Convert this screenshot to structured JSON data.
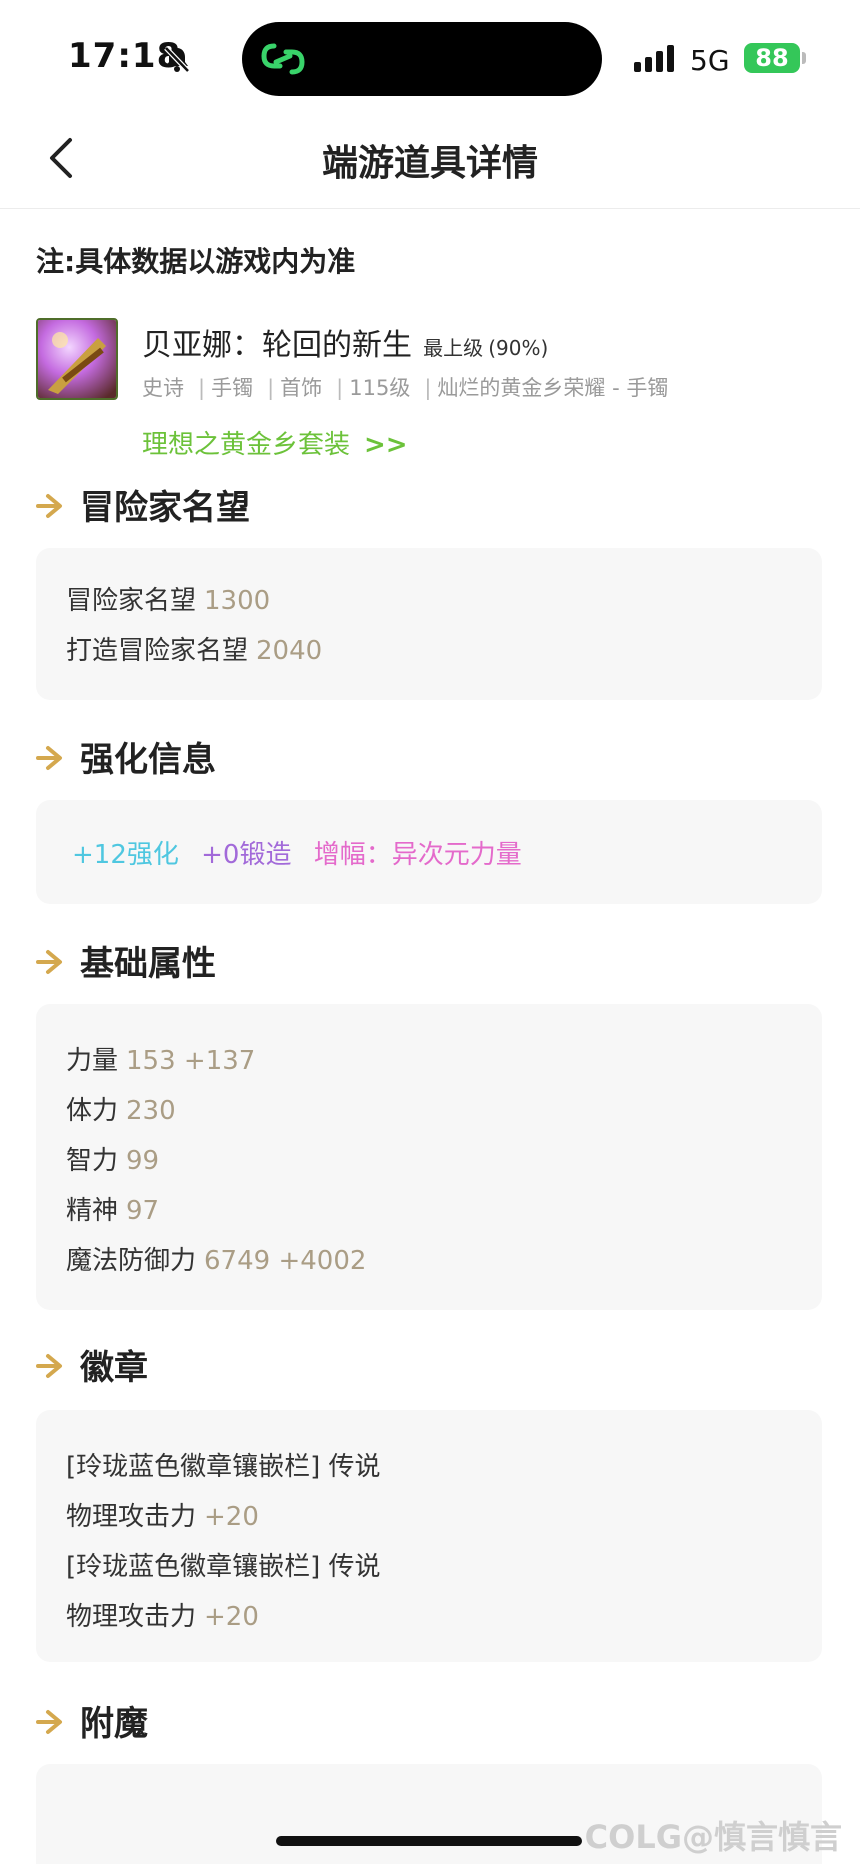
{
  "status_bar": {
    "time": "17:18",
    "network": "5G",
    "battery": "88"
  },
  "nav": {
    "title": "端游道具详情"
  },
  "note": "注:具体数据以游戏内为准",
  "item": {
    "name": "贝亚娜：轮回的新生",
    "grade": "最上级",
    "grade_pct": "(90%)",
    "meta": [
      "史诗",
      "手镯",
      "首饰",
      "115级",
      "灿烂的黄金乡荣耀 - 手镯"
    ],
    "set_link": "理想之黄金乡套装",
    "set_arrows": ">>"
  },
  "sections": {
    "reputation": {
      "title": "冒险家名望",
      "rows": [
        {
          "label": "冒险家名望",
          "value": "1300"
        },
        {
          "label": "打造冒险家名望",
          "value": "2040"
        }
      ]
    },
    "enhance": {
      "title": "强化信息",
      "reinforce": "+12强化",
      "forge": "+0锻造",
      "amplify": "增幅：异次元力量"
    },
    "base": {
      "title": "基础属性",
      "rows": [
        {
          "label": "力量",
          "value": "153 +137"
        },
        {
          "label": "体力",
          "value": "230"
        },
        {
          "label": "智力",
          "value": "99"
        },
        {
          "label": "精神",
          "value": "97"
        },
        {
          "label": "魔法防御力",
          "value": "6749 +4002"
        }
      ]
    },
    "emblem": {
      "title": "徽章",
      "rows": [
        {
          "label": "[玲珑蓝色徽章镶嵌栏] 传说",
          "value": ""
        },
        {
          "label": "物理攻击力",
          "value": "+20"
        },
        {
          "label": "[玲珑蓝色徽章镶嵌栏] 传说",
          "value": ""
        },
        {
          "label": "物理攻击力",
          "value": "+20"
        }
      ]
    },
    "enchant": {
      "title": "附魔"
    }
  },
  "watermark": "COLG@慎言慎言",
  "colors": {
    "accent_green": "#6cc23a",
    "arrow_gold": "#d4a84e",
    "value_text": "#aa9d85"
  }
}
